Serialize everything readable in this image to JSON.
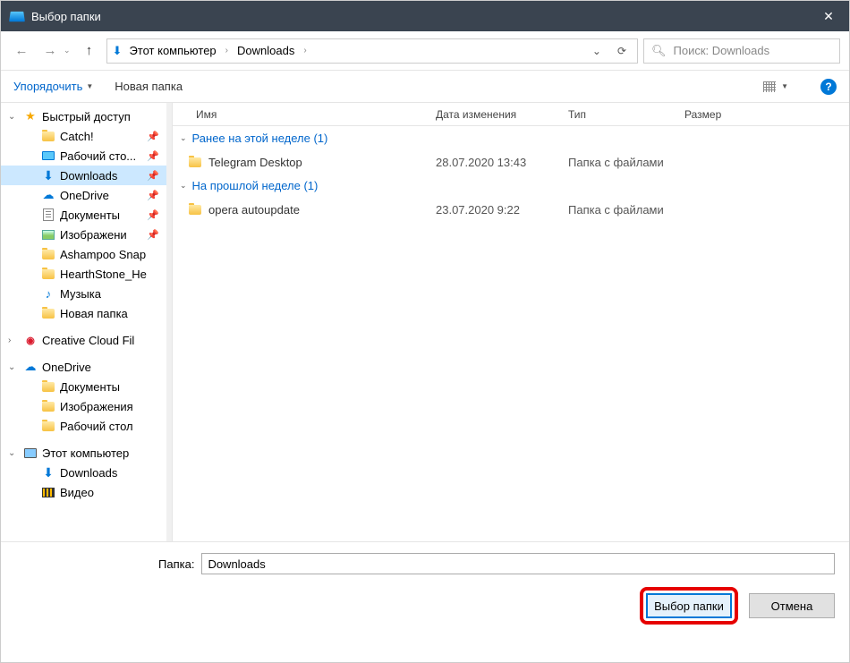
{
  "titlebar": {
    "title": "Выбор папки"
  },
  "nav": {
    "breadcrumb": [
      "Этот компьютер",
      "Downloads"
    ],
    "search_placeholder": "Поиск: Downloads"
  },
  "toolbar": {
    "organize": "Упорядочить",
    "new_folder": "Новая папка"
  },
  "columns": {
    "name": "Имя",
    "date": "Дата изменения",
    "type": "Тип",
    "size": "Размер"
  },
  "sidebar": {
    "quick_access": "Быстрый доступ",
    "items_qa": [
      {
        "label": "Catch!",
        "icon": "folder",
        "pin": true
      },
      {
        "label": "Рабочий сто...",
        "icon": "desktop",
        "pin": true
      },
      {
        "label": "Downloads",
        "icon": "download",
        "pin": true,
        "selected": true
      },
      {
        "label": "OneDrive",
        "icon": "onedrive",
        "pin": true
      },
      {
        "label": "Документы",
        "icon": "docs",
        "pin": true
      },
      {
        "label": "Изображени",
        "icon": "img",
        "pin": true
      },
      {
        "label": "Ashampoo Snap",
        "icon": "folder"
      },
      {
        "label": "HearthStone_He",
        "icon": "folder"
      },
      {
        "label": "Музыка",
        "icon": "music"
      },
      {
        "label": "Новая папка",
        "icon": "folder"
      }
    ],
    "creative_cloud": "Creative Cloud Fil",
    "onedrive": "OneDrive",
    "items_od": [
      {
        "label": "Документы",
        "icon": "folder"
      },
      {
        "label": "Изображения",
        "icon": "folder"
      },
      {
        "label": "Рабочий стол",
        "icon": "folder"
      }
    ],
    "this_pc": "Этот компьютер",
    "items_pc": [
      {
        "label": "Downloads",
        "icon": "download"
      },
      {
        "label": "Видео",
        "icon": "video"
      }
    ]
  },
  "groups": [
    {
      "title": "Ранее на этой неделе (1)",
      "rows": [
        {
          "name": "Telegram Desktop",
          "date": "28.07.2020 13:43",
          "type": "Папка с файлами",
          "size": ""
        }
      ]
    },
    {
      "title": "На прошлой неделе (1)",
      "rows": [
        {
          "name": "opera autoupdate",
          "date": "23.07.2020 9:22",
          "type": "Папка с файлами",
          "size": ""
        }
      ]
    }
  ],
  "bottom": {
    "folder_label": "Папка:",
    "folder_value": "Downloads",
    "select_btn": "Выбор папки",
    "cancel_btn": "Отмена"
  }
}
